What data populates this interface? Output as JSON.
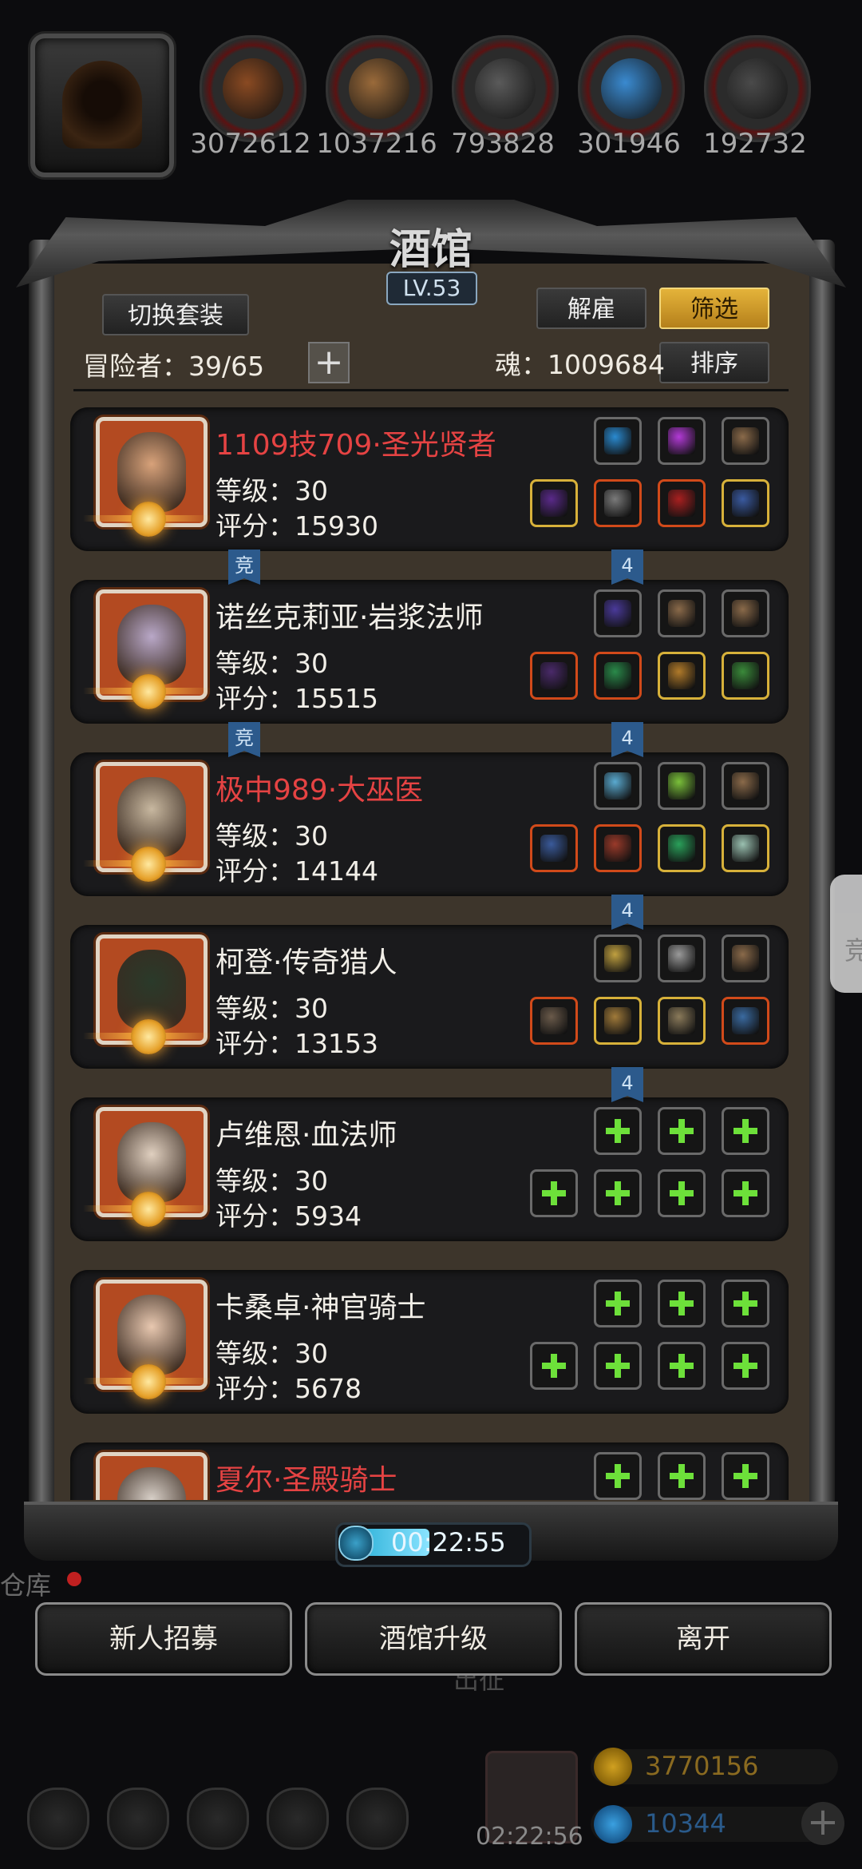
{
  "resources": [
    {
      "value": "3072612",
      "name": "wood-log-icon",
      "color": "#8a4a22"
    },
    {
      "value": "1037216",
      "name": "plank-icon",
      "color": "#9a6a3a"
    },
    {
      "value": "793828",
      "name": "iron-ingot-icon",
      "color": "#5a5a5a"
    },
    {
      "value": "301946",
      "name": "crystal-icon",
      "color": "#3a8ad0"
    },
    {
      "value": "192732",
      "name": "steel-bar-icon",
      "color": "#4a4a4a"
    }
  ],
  "panel": {
    "title": "酒馆",
    "level": "LV.53",
    "switch_outfit": "切换套装",
    "dismiss": "解雇",
    "filter": "筛选",
    "sort": "排序",
    "adventurers": "冒险者：39/65",
    "soul": "魂：1009684"
  },
  "heroes": [
    {
      "name": "1109技709·圣光贤者",
      "red": true,
      "level": "等级：30",
      "score": "评分：15930",
      "face": "#d8a27a",
      "top_slots": [
        {
          "q": "gray",
          "c": "#2a8ad0"
        },
        {
          "q": "gray",
          "c": "#b23ad6"
        },
        {
          "q": "gray",
          "c": "#8a6a4a"
        }
      ],
      "bottom_slots": [
        {
          "q": "gold",
          "c": "#5a2a8a"
        },
        {
          "q": "orange",
          "c": "#7a7a7a"
        },
        {
          "q": "orange",
          "c": "#a82020"
        },
        {
          "q": "gold",
          "c": "#3a5aa0"
        }
      ]
    },
    {
      "name": "诺丝克莉亚·岩浆法师",
      "red": false,
      "level": "等级：30",
      "score": "评分：15515",
      "face": "#b9a8c8",
      "top_slots": [
        {
          "q": "gray",
          "c": "#4a3a9a"
        },
        {
          "q": "gray",
          "c": "#8a6a4a"
        },
        {
          "q": "gray",
          "c": "#8a6a4a"
        }
      ],
      "bottom_slots": [
        {
          "q": "orange",
          "c": "#4a2a6a"
        },
        {
          "q": "orange",
          "c": "#2a8a4a"
        },
        {
          "q": "gold",
          "c": "#b07a2a"
        },
        {
          "q": "gold",
          "c": "#3a8a3a"
        }
      ]
    },
    {
      "name": "极中989·大巫医",
      "red": true,
      "level": "等级：30",
      "score": "评分：14144",
      "face": "#c8b8a0",
      "top_slots": [
        {
          "q": "gray",
          "c": "#5aaad0"
        },
        {
          "q": "gray",
          "c": "#7ac03a"
        },
        {
          "q": "gray",
          "c": "#8a6a4a"
        }
      ],
      "bottom_slots": [
        {
          "q": "orange",
          "c": "#3a5a9a"
        },
        {
          "q": "orange",
          "c": "#9a3a2a"
        },
        {
          "q": "gold",
          "c": "#2aa05a"
        },
        {
          "q": "gold",
          "c": "#9ac0b0"
        }
      ]
    },
    {
      "name": "柯登·传奇猎人",
      "red": false,
      "level": "等级：30",
      "score": "评分：13153",
      "face": "#2a3a2a",
      "top_slots": [
        {
          "q": "gray",
          "c": "#c0a040"
        },
        {
          "q": "gray",
          "c": "#9a9a9a"
        },
        {
          "q": "gray",
          "c": "#8a6a4a"
        }
      ],
      "bottom_slots": [
        {
          "q": "orange",
          "c": "#6a5a4a"
        },
        {
          "q": "gold",
          "c": "#a07a3a"
        },
        {
          "q": "gold",
          "c": "#8a7a5a"
        },
        {
          "q": "orange",
          "c": "#3a6aa0"
        }
      ]
    },
    {
      "name": "卢维恩·血法师",
      "red": false,
      "level": "等级：30",
      "score": "评分：5934",
      "face": "#e0d0c0",
      "top_slots": [
        {
          "q": "add"
        },
        {
          "q": "add"
        },
        {
          "q": "add"
        }
      ],
      "bottom_slots": [
        {
          "q": "add"
        },
        {
          "q": "add"
        },
        {
          "q": "add"
        },
        {
          "q": "add"
        }
      ]
    },
    {
      "name": "卡桑卓·神官骑士",
      "red": false,
      "level": "等级：30",
      "score": "评分：5678",
      "face": "#e8c8b0",
      "top_slots": [
        {
          "q": "add"
        },
        {
          "q": "add"
        },
        {
          "q": "add"
        }
      ],
      "bottom_slots": [
        {
          "q": "add"
        },
        {
          "q": "add"
        },
        {
          "q": "add"
        },
        {
          "q": "add"
        }
      ]
    },
    {
      "name": "夏尔·圣殿骑士",
      "red": true,
      "level": "",
      "score": "",
      "face": "#d8d0c8",
      "top_slots": [
        {
          "q": "add"
        },
        {
          "q": "add"
        },
        {
          "q": "add"
        }
      ],
      "bottom_slots": []
    }
  ],
  "connectors": [
    {
      "left_label": "竞",
      "right_label": "4"
    },
    {
      "left_label": "竞",
      "right_label": "4"
    },
    {
      "left_label": "",
      "right_label": "4"
    },
    {
      "left_label": "",
      "right_label": "4"
    }
  ],
  "timer": "00:22:55",
  "bottom_buttons": {
    "recruit": "新人招募",
    "upgrade": "酒馆升级",
    "leave": "离开"
  },
  "background": {
    "warehouse": "仓库",
    "expedition": "出征",
    "time2": "02:22:56",
    "gold": "3770156",
    "gem": "10344",
    "side_char": "竞"
  }
}
